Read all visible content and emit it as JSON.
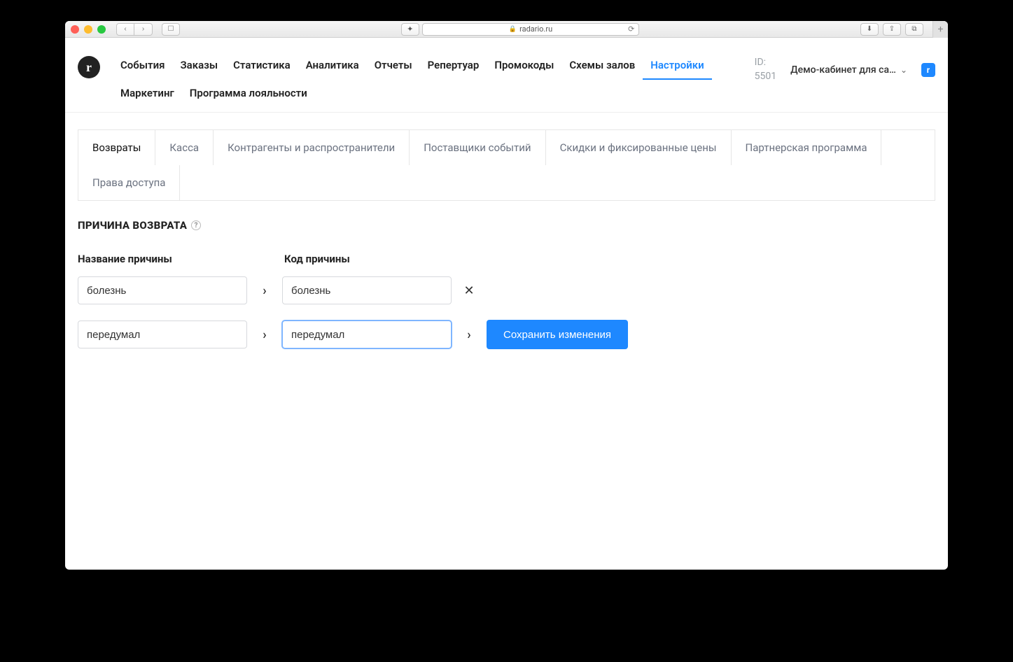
{
  "browser": {
    "url_host": "radario.ru"
  },
  "header": {
    "logo_letter": "r",
    "nav": [
      "События",
      "Заказы",
      "Статистика",
      "Аналитика",
      "Отчеты",
      "Репертуар",
      "Промокоды",
      "Схемы залов",
      "Настройки",
      "Маркетинг",
      "Программа лояльности"
    ],
    "nav_active_index": 8,
    "id_label": "ID:",
    "id_value": "5501",
    "account_label": "Демо-кабинет для са…",
    "square_icon_letter": "r"
  },
  "tabs": {
    "items": [
      "Возвраты",
      "Касса",
      "Контрагенты и распространители",
      "Поставщики событий",
      "Скидки и фиксированные цены",
      "Партнерская программа",
      "Права доступа"
    ],
    "active_index": 0
  },
  "section": {
    "title": "ПРИЧИНА ВОЗВРАТА",
    "help_char": "?"
  },
  "form": {
    "col1_label": "Название причины",
    "col2_label": "Код причины",
    "rows": [
      {
        "name": "болезнь",
        "code": "болезнь",
        "action": "delete"
      },
      {
        "name": "передумал",
        "code": "передумал",
        "action": "save",
        "focused": true
      }
    ],
    "save_button": "Сохранить изменения"
  }
}
